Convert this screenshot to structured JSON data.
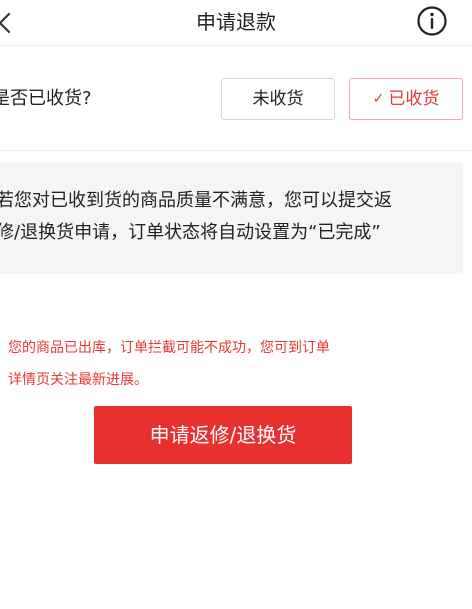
{
  "header": {
    "title": "申请退款",
    "back_icon": "chevron-left-icon",
    "info_icon": "info-circle-icon"
  },
  "question": {
    "label": "是否已收货?",
    "options": [
      {
        "label": "未收货",
        "selected": false
      },
      {
        "label": "已收货",
        "selected": true
      }
    ],
    "selected_check_icon": "check-icon"
  },
  "notice": {
    "lines": [
      "若您对已收到货的商品质量不满意，您可以提交返",
      "修/退换货申请，订单状态将自动设置为“已完成”"
    ]
  },
  "warning": {
    "lines": [
      "您的商品已出库，订单拦截可能不成功，您可到订单",
      "详情页关注最新进展。"
    ]
  },
  "primary_action": {
    "label": "申请返修/退换货"
  },
  "colors": {
    "accent": "#e8312f",
    "accent_text": "#e53935",
    "notice_bg": "#f5f5f5",
    "divider": "#ececec"
  }
}
